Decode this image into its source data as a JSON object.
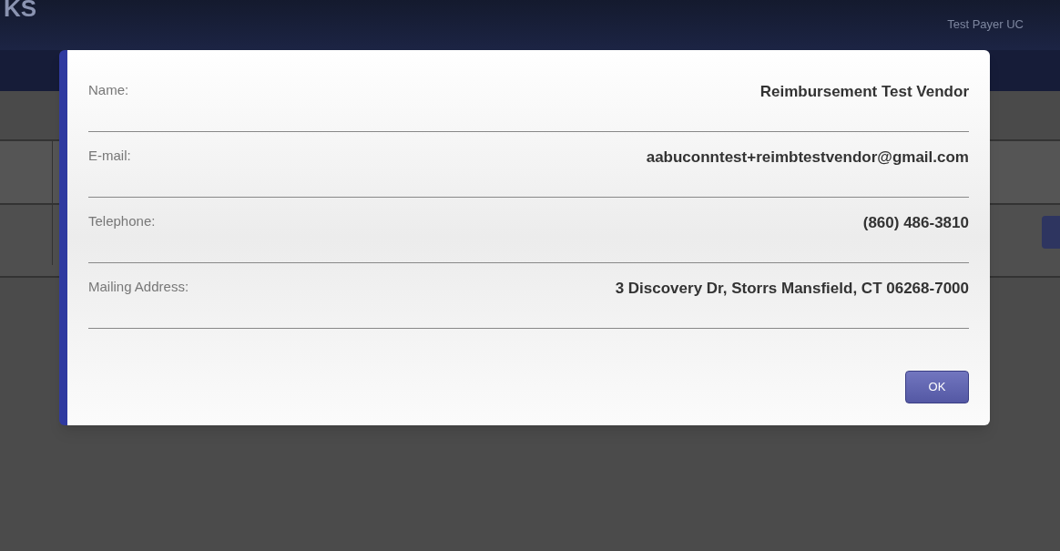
{
  "header": {
    "logo_text": "KS",
    "user": "Test Payer UC"
  },
  "dialog": {
    "fields": [
      {
        "label": "Name:",
        "value": "Reimbursement Test Vendor"
      },
      {
        "label": "E-mail:",
        "value": "aabuconntest+reimbtestvendor@gmail.com"
      },
      {
        "label": "Telephone:",
        "value": "(860) 486-3810"
      },
      {
        "label": "Mailing Address:",
        "value": "3 Discovery Dr, Storrs Mansfield, CT 06268-7000"
      }
    ],
    "buttons": [
      "OK"
    ]
  }
}
